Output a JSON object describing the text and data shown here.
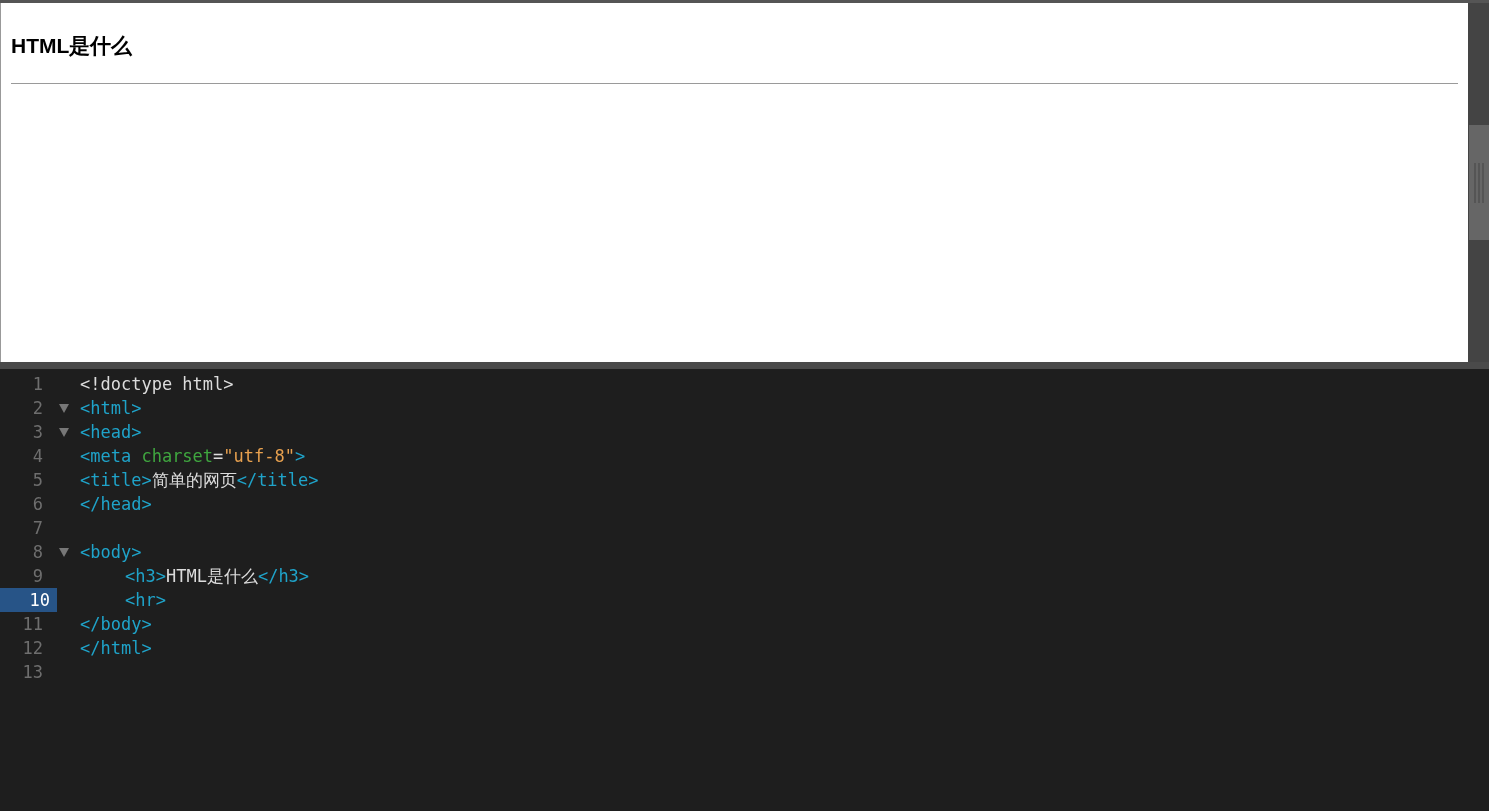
{
  "preview": {
    "heading": "HTML是什么"
  },
  "editor": {
    "lines": [
      {
        "number": "1",
        "foldable": false,
        "selected": false,
        "tokens": [
          {
            "kind": "plain",
            "text": "<!doctype html>"
          }
        ]
      },
      {
        "number": "2",
        "foldable": true,
        "selected": false,
        "tokens": [
          {
            "kind": "tag",
            "text": "<html>"
          }
        ]
      },
      {
        "number": "3",
        "foldable": true,
        "selected": false,
        "tokens": [
          {
            "kind": "tag",
            "text": "<head>"
          }
        ]
      },
      {
        "number": "4",
        "foldable": false,
        "selected": false,
        "tokens": [
          {
            "kind": "tag",
            "text": "<meta "
          },
          {
            "kind": "attr",
            "text": "charset"
          },
          {
            "kind": "plain",
            "text": "="
          },
          {
            "kind": "string",
            "text": "\"utf-8\""
          },
          {
            "kind": "tag",
            "text": ">"
          }
        ]
      },
      {
        "number": "5",
        "foldable": false,
        "selected": false,
        "tokens": [
          {
            "kind": "tag",
            "text": "<title>"
          },
          {
            "kind": "plain",
            "text": "简单的网页"
          },
          {
            "kind": "tag",
            "text": "</title>"
          }
        ]
      },
      {
        "number": "6",
        "foldable": false,
        "selected": false,
        "tokens": [
          {
            "kind": "tag",
            "text": "</head>"
          }
        ]
      },
      {
        "number": "7",
        "foldable": false,
        "selected": false
      },
      {
        "number": "8",
        "foldable": true,
        "selected": false,
        "tokens": [
          {
            "kind": "tag",
            "text": "<body>"
          }
        ],
        "children": [
          {
            "number": "9",
            "foldable": false,
            "selected": false,
            "tokens": [
              {
                "kind": "tag",
                "text": "<h3>"
              },
              {
                "kind": "plain",
                "text": "HTML是什么"
              },
              {
                "kind": "tag",
                "text": "</h3>"
              }
            ]
          },
          {
            "number": "10",
            "foldable": false,
            "selected": true,
            "tokens": [
              {
                "kind": "tag",
                "text": "<hr>"
              }
            ]
          }
        ]
      },
      {
        "number": "11",
        "foldable": false,
        "selected": false,
        "tokens": [
          {
            "kind": "tag",
            "text": "</body>"
          }
        ]
      },
      {
        "number": "12",
        "foldable": false,
        "selected": false,
        "tokens": [
          {
            "kind": "tag",
            "text": "</html>"
          }
        ]
      },
      {
        "number": "13",
        "foldable": false,
        "selected": false
      }
    ]
  }
}
